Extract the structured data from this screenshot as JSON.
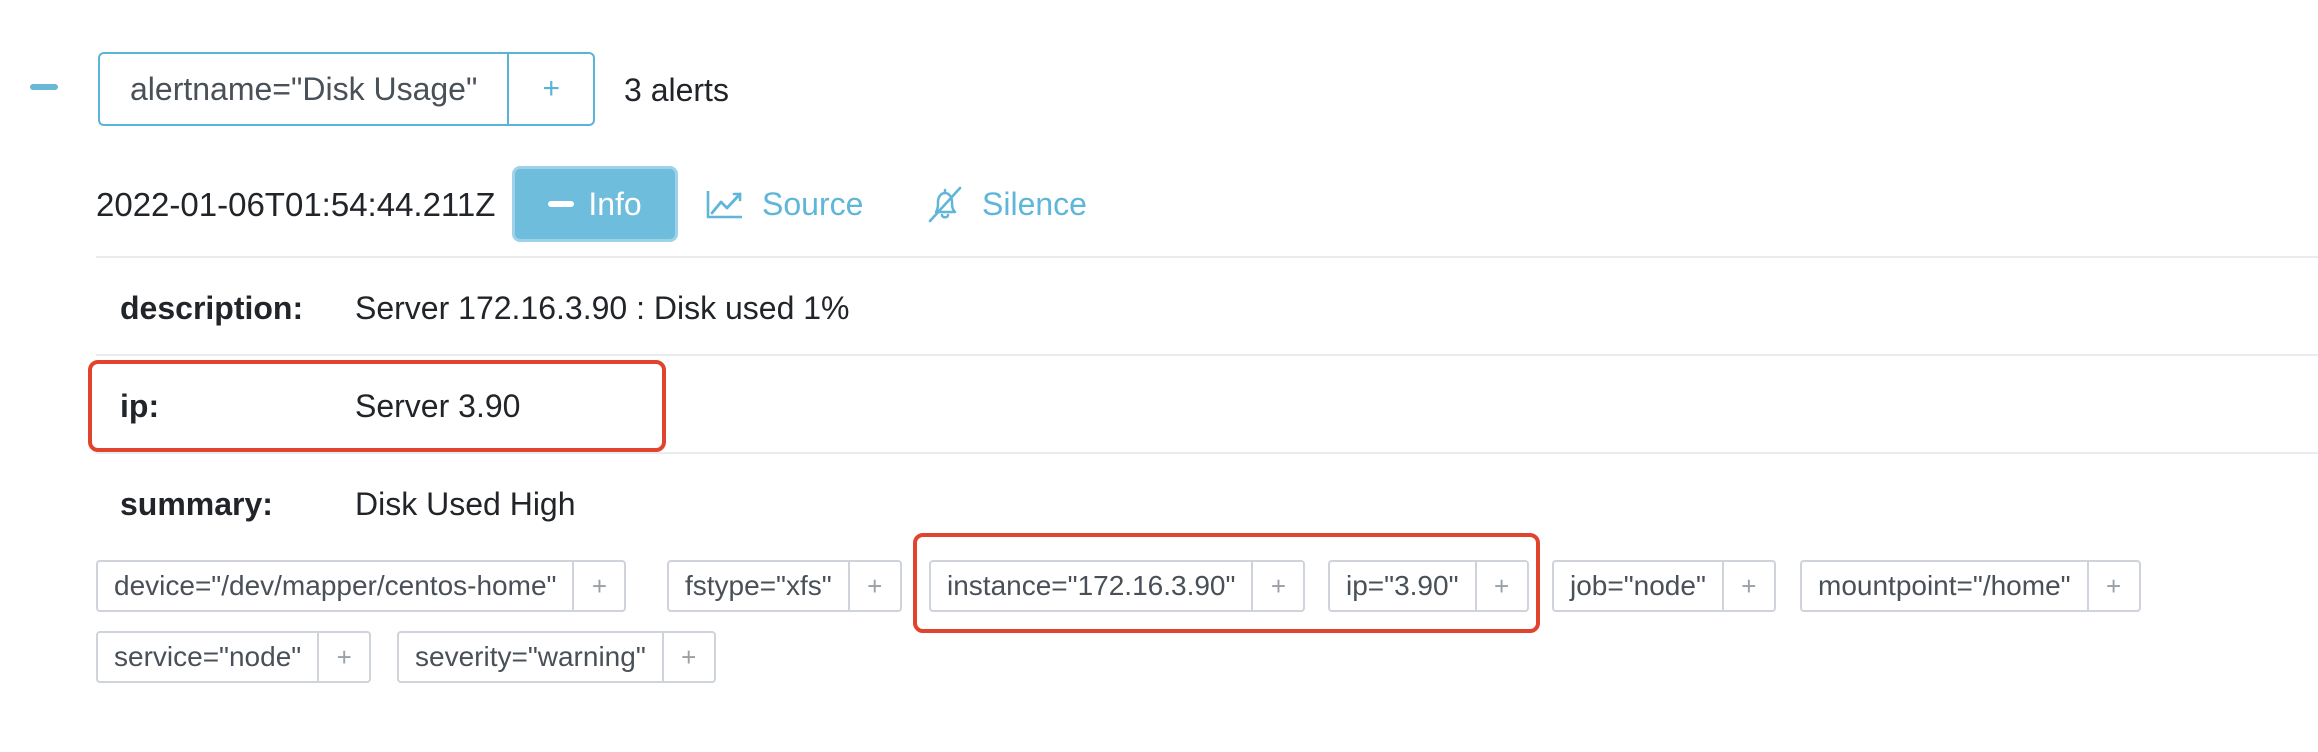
{
  "group": {
    "label": "alertname=\"Disk Usage\"",
    "add_symbol": "+",
    "count_text": "3 alerts",
    "collapse_icon": "minus-icon"
  },
  "alert": {
    "timestamp": "2022-01-06T01:54:44.211Z",
    "info_label": "Info",
    "source_label": "Source",
    "silence_label": "Silence",
    "icons": {
      "info": "minus-icon",
      "source": "line-chart-icon",
      "silence": "bell-slash-icon"
    },
    "accent_color": "#5fb6d8",
    "highlight_color": "#e0442f"
  },
  "annotations": [
    {
      "key": "description:",
      "value": "Server 172.16.3.90 : Disk used 1%"
    },
    {
      "key": "ip:",
      "value": "Server 3.90"
    },
    {
      "key": "summary:",
      "value": "Disk Used High"
    }
  ],
  "labels": [
    {
      "text": "device=\"/dev/mapper/centos-home\"",
      "add": "+"
    },
    {
      "text": "fstype=\"xfs\"",
      "add": "+"
    },
    {
      "text": "instance=\"172.16.3.90\"",
      "add": "+"
    },
    {
      "text": "ip=\"3.90\"",
      "add": "+"
    },
    {
      "text": "job=\"node\"",
      "add": "+"
    },
    {
      "text": "mountpoint=\"/home\"",
      "add": "+"
    },
    {
      "text": "service=\"node\"",
      "add": "+"
    },
    {
      "text": "severity=\"warning\"",
      "add": "+"
    }
  ]
}
